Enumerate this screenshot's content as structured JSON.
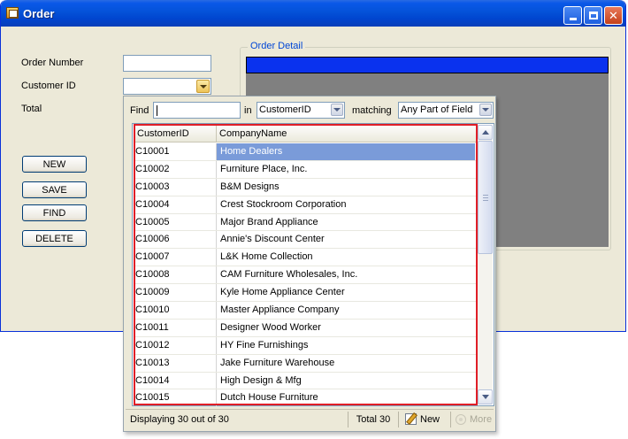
{
  "window": {
    "title": "Order",
    "controls": [
      "minimize",
      "maximize",
      "close"
    ]
  },
  "form": {
    "order_number_label": "Order Number",
    "customer_id_label": "Customer ID",
    "total_label": "Total",
    "order_number_value": "",
    "customer_id_value": ""
  },
  "buttons": {
    "new": "NEW",
    "save": "SAVE",
    "find": "FIND",
    "delete": "DELETE"
  },
  "detail": {
    "legend": "Order Detail"
  },
  "popup": {
    "find_label": "Find",
    "find_value": "",
    "in_label": "in",
    "in_value": "CustomerID",
    "matching_label": "matching",
    "matching_value": "Any Part of Field",
    "columns": [
      "CustomerID",
      "CompanyName"
    ],
    "rows": [
      [
        "C10001",
        "Home Dealers"
      ],
      [
        "C10002",
        "Furniture Place, Inc."
      ],
      [
        "C10003",
        "B&M Designs"
      ],
      [
        "C10004",
        "Crest Stockroom Corporation"
      ],
      [
        "C10005",
        "Major Brand Appliance"
      ],
      [
        "C10006",
        "Annie's Discount Center"
      ],
      [
        "C10007",
        "L&K Home Collection"
      ],
      [
        "C10008",
        "CAM Furniture Wholesales, Inc."
      ],
      [
        "C10009",
        "Kyle Home Appliance Center"
      ],
      [
        "C10010",
        "Master Appliance Company"
      ],
      [
        "C10011",
        "Designer Wood Worker"
      ],
      [
        "C10012",
        "HY Fine Furnishings"
      ],
      [
        "C10013",
        "Jake Furniture Warehouse"
      ],
      [
        "C10014",
        "High Design & Mfg"
      ],
      [
        "C10015",
        "Dutch House Furniture"
      ]
    ],
    "selected_row": 0,
    "status": "Displaying 30 out of 30",
    "total": "Total 30",
    "new_label": "New",
    "more_label": "More"
  },
  "colors": {
    "title_bar": "#0452d8",
    "selection": "#7a9bd9",
    "highlight_outline": "#e01e27",
    "detail_header": "#0a32ee"
  }
}
